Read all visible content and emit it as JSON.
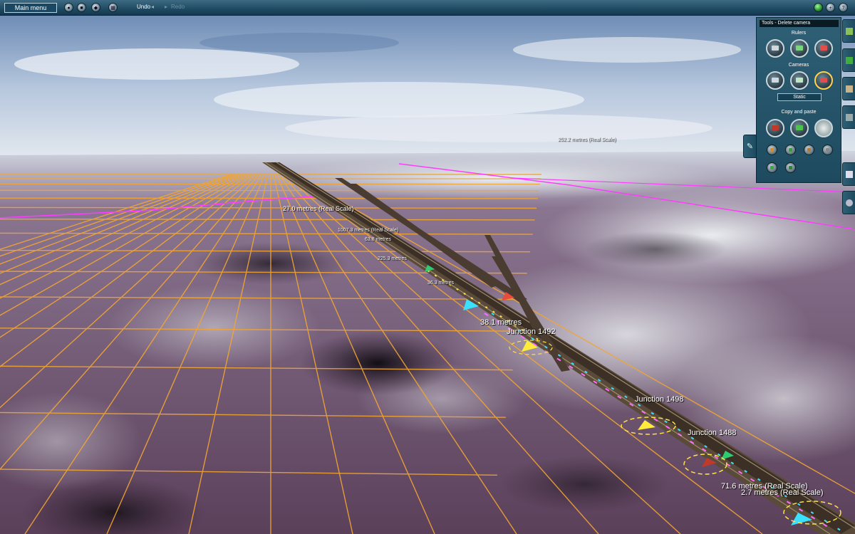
{
  "toolbar": {
    "main_menu_label": "Main menu",
    "undo_label": "Undo",
    "redo_label": "Redo"
  },
  "panel": {
    "title": "Tools - Delete camera",
    "rulers_label": "Rulers",
    "cameras_label": "Cameras",
    "camera_mode": "Static",
    "copy_paste_label": "Copy and paste"
  },
  "scene": {
    "junction_labels": [
      "Junction 1492",
      "Junction 1498",
      "Junction 1488"
    ],
    "measure_labels": [
      "38.1 metres",
      "71.6 metres  (Real Scale)",
      "2.7 metres  (Real Scale)",
      "27.0 metres  (Real Scale)",
      "36.3 metres",
      "225.3 metres",
      "63.8 metres",
      "1007.3 metres  (Real Scale)",
      "252.2 metres  (Real Scale)"
    ]
  },
  "colors": {
    "toolbar": "#1f4a63",
    "panel": "#2a586d",
    "grid": "#f2a533",
    "terrain_purple": "#6e506e",
    "snow": "#dde3e6",
    "magenta_line": "#ff3cff",
    "sky": "#8fa9c7"
  },
  "icons": [
    "gear-icon",
    "stop-icon",
    "nav-icon",
    "grid-icon",
    "undo-arrow-icon",
    "redo-arrow-icon",
    "green-indicator-icon",
    "plus-icon",
    "help-icon",
    "ruler-icon",
    "camera-icon",
    "delete-icon",
    "copy-icon",
    "paste-icon",
    "compass-icon",
    "wrench-icon",
    "paint-icon",
    "track-icon",
    "object-icon",
    "terrain-icon",
    "layers-icon",
    "eye-icon"
  ]
}
